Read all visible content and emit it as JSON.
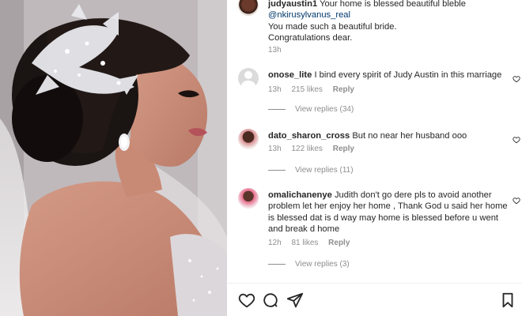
{
  "comments": [
    {
      "username": "judyaustin1",
      "text": "Your home is blessed beautiful bleble",
      "mention": "@nkirusylvanus_real",
      "line2": "You made such a beautiful bride.",
      "line3": "Congratulations dear.",
      "time": "13h"
    },
    {
      "username": "onose_lite",
      "text": "I bind every spirit of Judy Austin in this marriage",
      "time": "13h",
      "likes": "215 likes",
      "reply": "Reply",
      "view_replies": "View replies (34)"
    },
    {
      "username": "dato_sharon_cross",
      "text": "But no near her husband ooo",
      "time": "13h",
      "likes": "122 likes",
      "reply": "Reply",
      "view_replies": "View replies (11)"
    },
    {
      "username": "omalichanenye",
      "text": "Judith don't go dere pls to avoid another problem let her enjoy her home , Thank God u said her home is blessed dat is d way may home is blessed before u went and break d home",
      "time": "12h",
      "likes": "81 likes",
      "reply": "Reply",
      "view_replies": "View replies (3)"
    }
  ],
  "actions": {
    "like_icon": "heart-icon",
    "comment_icon": "comment-icon",
    "share_icon": "share-icon",
    "save_icon": "bookmark-icon"
  },
  "colors": {
    "text": "#262626",
    "meta": "#8e8e8e",
    "mention": "#00376b"
  }
}
